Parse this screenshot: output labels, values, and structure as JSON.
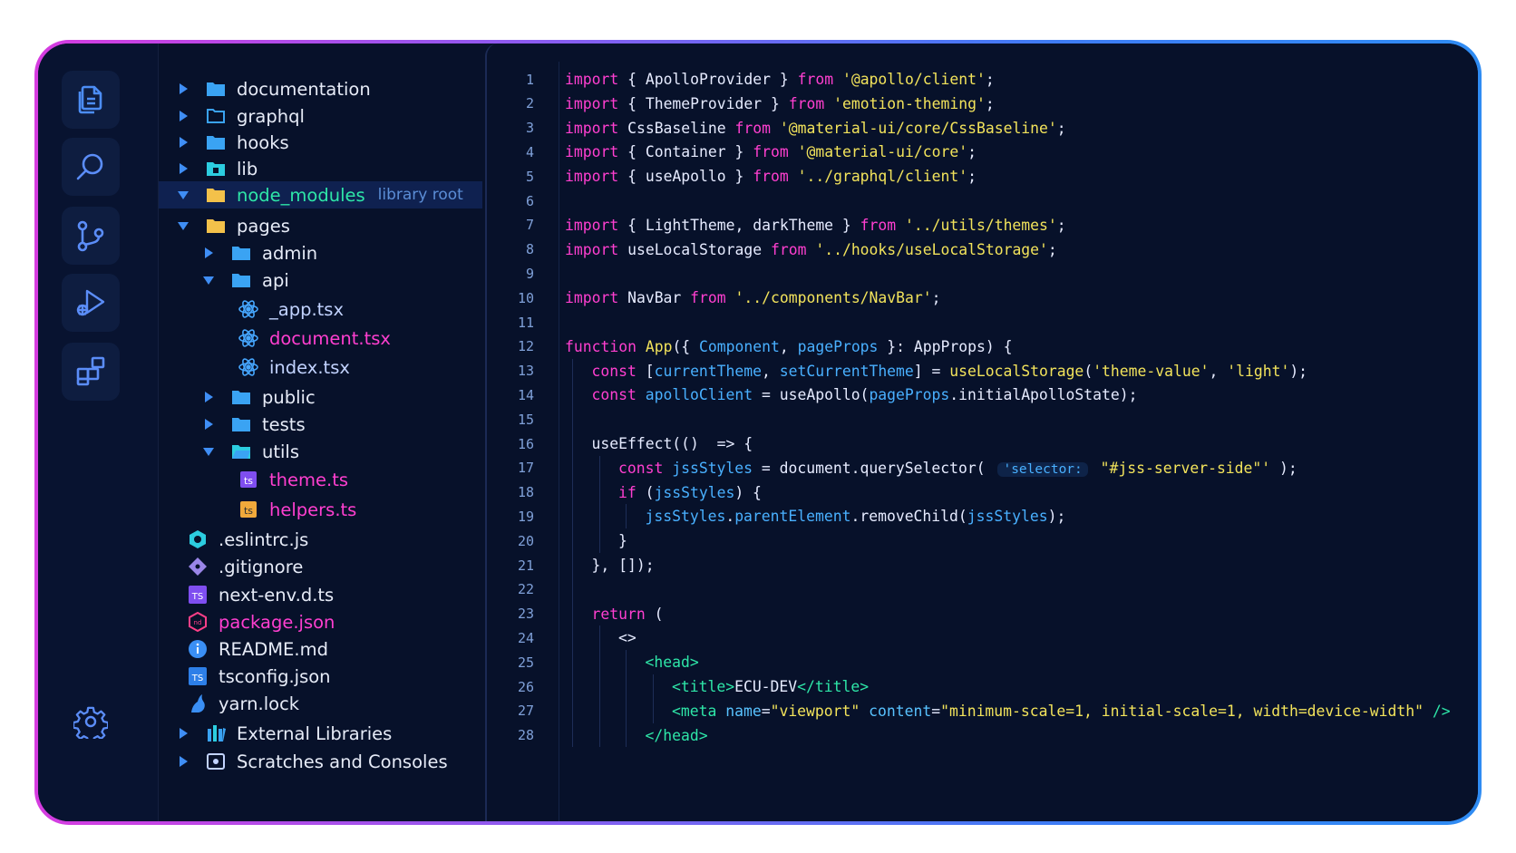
{
  "activity": {
    "items": [
      {
        "name": "explorer-icon",
        "color": "#4c8df5"
      },
      {
        "name": "search-icon",
        "color": "#5b8df8"
      },
      {
        "name": "source-control-icon",
        "color": "#5b8df8"
      },
      {
        "name": "run-debug-icon",
        "color": "#5b8df8"
      },
      {
        "name": "extensions-icon",
        "color": "#5b8df8"
      }
    ],
    "settings_icon": "gear-icon"
  },
  "tree": {
    "items": [
      {
        "label": "documentation",
        "kind": "folder",
        "arrow": "right",
        "level": 0,
        "color": "#e6ebf7"
      },
      {
        "label": "graphql",
        "kind": "folder-outline",
        "arrow": "right",
        "level": 0,
        "color": "#e6ebf7"
      },
      {
        "label": "hooks",
        "kind": "folder",
        "arrow": "right",
        "level": 0,
        "color": "#e6ebf7"
      },
      {
        "label": "lib",
        "kind": "folder-lib",
        "arrow": "right",
        "level": 0,
        "color": "#e6ebf7"
      },
      {
        "label": "node_modules",
        "kind": "folder-yellow",
        "arrow": "down",
        "level": 0,
        "color": "#2ee6a8",
        "note": "library root",
        "selected": true
      },
      {
        "label": "pages",
        "kind": "folder-yellow",
        "arrow": "down",
        "level": 0,
        "color": "#e6ebf7"
      },
      {
        "label": "admin",
        "kind": "folder",
        "arrow": "right",
        "level": 1,
        "color": "#e6ebf7"
      },
      {
        "label": "api",
        "kind": "folder",
        "arrow": "down",
        "level": 1,
        "color": "#e6ebf7"
      },
      {
        "label": "_app.tsx",
        "kind": "react",
        "arrow": "none",
        "level": 2,
        "color": "#c2d3ff"
      },
      {
        "label": "document.tsx",
        "kind": "react",
        "arrow": "none",
        "level": 2,
        "color": "#ff3fd0"
      },
      {
        "label": "index.tsx",
        "kind": "react",
        "arrow": "none",
        "level": 2,
        "color": "#c2d3ff"
      },
      {
        "label": "public",
        "kind": "folder",
        "arrow": "right",
        "level": 1,
        "color": "#e6ebf7"
      },
      {
        "label": "tests",
        "kind": "folder",
        "arrow": "right",
        "level": 1,
        "color": "#e6ebf7"
      },
      {
        "label": "utils",
        "kind": "folder-open",
        "arrow": "down",
        "level": 1,
        "color": "#e6ebf7"
      },
      {
        "label": "theme.ts",
        "kind": "ts-purple",
        "arrow": "none",
        "level": 2,
        "color": "#ff3fd0"
      },
      {
        "label": "helpers.ts",
        "kind": "ts-orange",
        "arrow": "none",
        "level": 2,
        "color": "#ff3fd0"
      },
      {
        "label": ".eslintrc.js",
        "kind": "eslint",
        "arrow": "none",
        "level": 0,
        "color": "#e6ebf7"
      },
      {
        "label": ".gitignore",
        "kind": "git",
        "arrow": "none",
        "level": 0,
        "color": "#e6ebf7"
      },
      {
        "label": "next-env.d.ts",
        "kind": "ts-badge-purple",
        "arrow": "none",
        "level": 0,
        "color": "#e6ebf7"
      },
      {
        "label": "package.json",
        "kind": "npm",
        "arrow": "none",
        "level": 0,
        "color": "#ff3fd0"
      },
      {
        "label": "README.md",
        "kind": "info",
        "arrow": "none",
        "level": 0,
        "color": "#e6ebf7"
      },
      {
        "label": "tsconfig.json",
        "kind": "ts-badge-blue",
        "arrow": "none",
        "level": 0,
        "color": "#e6ebf7"
      },
      {
        "label": "yarn.lock",
        "kind": "yarn",
        "arrow": "none",
        "level": 0,
        "color": "#e6ebf7"
      },
      {
        "label": "External Libraries",
        "kind": "libraries",
        "arrow": "right",
        "level": -1,
        "color": "#e6ebf7"
      },
      {
        "label": "Scratches and Consoles",
        "kind": "scratches",
        "arrow": "right",
        "level": -1,
        "color": "#e6ebf7"
      }
    ]
  },
  "editor": {
    "lines": [
      {
        "n": "1",
        "indent": 0,
        "tokens": [
          [
            "kw",
            "import"
          ],
          [
            "pun",
            " { "
          ],
          [
            "pun",
            "ApolloProvider"
          ],
          [
            "pun",
            " } "
          ],
          [
            "kw",
            "from"
          ],
          [
            "pun",
            " "
          ],
          [
            "str",
            "'@apollo/client'"
          ],
          [
            "pun",
            ";"
          ]
        ]
      },
      {
        "n": "2",
        "indent": 0,
        "tokens": [
          [
            "kw",
            "import"
          ],
          [
            "pun",
            " { "
          ],
          [
            "pun",
            "ThemeProvider"
          ],
          [
            "pun",
            " } "
          ],
          [
            "kw",
            "from"
          ],
          [
            "pun",
            " "
          ],
          [
            "str",
            "'emotion-theming'"
          ],
          [
            "pun",
            ";"
          ]
        ]
      },
      {
        "n": "3",
        "indent": 0,
        "tokens": [
          [
            "kw",
            "import"
          ],
          [
            "pun",
            " CssBaseline "
          ],
          [
            "kw",
            "from"
          ],
          [
            "pun",
            " "
          ],
          [
            "str",
            "'@material-ui/core/CssBaseline'"
          ],
          [
            "pun",
            ";"
          ]
        ]
      },
      {
        "n": "4",
        "indent": 0,
        "tokens": [
          [
            "kw",
            "import"
          ],
          [
            "pun",
            " { "
          ],
          [
            "pun",
            "Container"
          ],
          [
            "pun",
            " } "
          ],
          [
            "kw",
            "from"
          ],
          [
            "pun",
            " "
          ],
          [
            "str",
            "'@material-ui/core'"
          ],
          [
            "pun",
            ";"
          ]
        ]
      },
      {
        "n": "5",
        "indent": 0,
        "tokens": [
          [
            "kw",
            "import"
          ],
          [
            "pun",
            " { "
          ],
          [
            "pun",
            "useApollo"
          ],
          [
            "pun",
            " } "
          ],
          [
            "kw",
            "from"
          ],
          [
            "pun",
            " "
          ],
          [
            "str",
            "'../graphql/client'"
          ],
          [
            "pun",
            ";"
          ]
        ]
      },
      {
        "n": "6",
        "indent": 0,
        "tokens": []
      },
      {
        "n": "7",
        "indent": 0,
        "tokens": [
          [
            "kw",
            "import"
          ],
          [
            "pun",
            " { LightTheme, darkTheme } "
          ],
          [
            "kw",
            "from"
          ],
          [
            "pun",
            " "
          ],
          [
            "str",
            "'../utils/themes'"
          ],
          [
            "pun",
            ";"
          ]
        ]
      },
      {
        "n": "8",
        "indent": 0,
        "tokens": [
          [
            "kw",
            "import"
          ],
          [
            "pun",
            " useLocalStorage "
          ],
          [
            "kw",
            "from"
          ],
          [
            "pun",
            " "
          ],
          [
            "str",
            "'../hooks/useLocalStorage'"
          ],
          [
            "pun",
            ";"
          ]
        ]
      },
      {
        "n": "9",
        "indent": 0,
        "tokens": []
      },
      {
        "n": "10",
        "indent": 0,
        "tokens": [
          [
            "kw",
            "import"
          ],
          [
            "pun",
            " NavBar "
          ],
          [
            "kw",
            "from"
          ],
          [
            "pun",
            " "
          ],
          [
            "str",
            "'../components/NavBar'"
          ],
          [
            "pun",
            ";"
          ]
        ]
      },
      {
        "n": "11",
        "indent": 0,
        "tokens": []
      },
      {
        "n": "12",
        "indent": 0,
        "tokens": [
          [
            "kw",
            "function"
          ],
          [
            "pun",
            " "
          ],
          [
            "fn",
            "App"
          ],
          [
            "pun",
            "({ "
          ],
          [
            "var",
            "Component"
          ],
          [
            "pun",
            ", "
          ],
          [
            "var",
            "pageProps"
          ],
          [
            "pun",
            " }: AppProps) {"
          ]
        ]
      },
      {
        "n": "13",
        "indent": 1,
        "tokens": [
          [
            "kw",
            "const"
          ],
          [
            "pun",
            " ["
          ],
          [
            "var",
            "currentTheme"
          ],
          [
            "pun",
            ", "
          ],
          [
            "var",
            "setCurrentTheme"
          ],
          [
            "pun",
            "] = "
          ],
          [
            "fn",
            "useLocalStorage"
          ],
          [
            "pun",
            "("
          ],
          [
            "str",
            "'theme-value'"
          ],
          [
            "pun",
            ", "
          ],
          [
            "str",
            "'light'"
          ],
          [
            "pun",
            ");"
          ]
        ]
      },
      {
        "n": "14",
        "indent": 1,
        "tokens": [
          [
            "kw",
            "const"
          ],
          [
            "pun",
            " "
          ],
          [
            "var",
            "apolloClient"
          ],
          [
            "pun",
            " = useApollo("
          ],
          [
            "var",
            "pageProps"
          ],
          [
            "pun",
            ".initialApolloState);"
          ]
        ]
      },
      {
        "n": "15",
        "indent": 1,
        "tokens": []
      },
      {
        "n": "16",
        "indent": 1,
        "tokens": [
          [
            "pun",
            "useEffect(() "
          ],
          [
            "pun",
            " => {"
          ]
        ]
      },
      {
        "n": "17",
        "indent": 2,
        "tokens": [
          [
            "kw",
            "const"
          ],
          [
            "pun",
            " "
          ],
          [
            "var",
            "jssStyles"
          ],
          [
            "pun",
            " = document.querySelector( "
          ],
          [
            "hint",
            "'selector:"
          ],
          [
            "pun",
            " "
          ],
          [
            "str",
            "\"#jss-server-side\"'"
          ],
          [
            "pun",
            " );"
          ]
        ]
      },
      {
        "n": "18",
        "indent": 2,
        "tokens": [
          [
            "kw",
            "if"
          ],
          [
            "pun",
            " ("
          ],
          [
            "var",
            "jssStyles"
          ],
          [
            "pun",
            ") {"
          ]
        ]
      },
      {
        "n": "19",
        "indent": 3,
        "tokens": [
          [
            "var",
            "jssStyles"
          ],
          [
            "pun",
            "."
          ],
          [
            "var",
            "parentElement"
          ],
          [
            "pun",
            ".removeChild("
          ],
          [
            "var",
            "jssStyles"
          ],
          [
            "pun",
            ");"
          ]
        ]
      },
      {
        "n": "20",
        "indent": 2,
        "tokens": [
          [
            "pun",
            "}"
          ]
        ]
      },
      {
        "n": "21",
        "indent": 1,
        "tokens": [
          [
            "pun",
            "}, []);"
          ]
        ]
      },
      {
        "n": "22",
        "indent": 1,
        "tokens": []
      },
      {
        "n": "23",
        "indent": 1,
        "tokens": [
          [
            "kw",
            "return"
          ],
          [
            "pun",
            " ("
          ]
        ]
      },
      {
        "n": "24",
        "indent": 2,
        "tokens": [
          [
            "pun",
            "<>"
          ]
        ]
      },
      {
        "n": "25",
        "indent": 3,
        "tokens": [
          [
            "tag",
            "<head>"
          ]
        ]
      },
      {
        "n": "26",
        "indent": 4,
        "tokens": [
          [
            "tag",
            "<title>"
          ],
          [
            "pun",
            "ECU-DEV"
          ],
          [
            "tag",
            "</title>"
          ]
        ]
      },
      {
        "n": "27",
        "indent": 4,
        "tokens": [
          [
            "tag",
            "<meta"
          ],
          [
            "pun",
            " "
          ],
          [
            "attr",
            "name"
          ],
          [
            "pun",
            "="
          ],
          [
            "str",
            "\"viewport\""
          ],
          [
            "pun",
            " "
          ],
          [
            "attr",
            "content"
          ],
          [
            "pun",
            "="
          ],
          [
            "str",
            "\"minimum-scale=1, initial-scale=1, width=device-width\""
          ],
          [
            "pun",
            " "
          ],
          [
            "tag",
            "/>"
          ]
        ]
      },
      {
        "n": "28",
        "indent": 3,
        "tokens": [
          [
            "tag",
            "</head>"
          ]
        ]
      }
    ]
  }
}
